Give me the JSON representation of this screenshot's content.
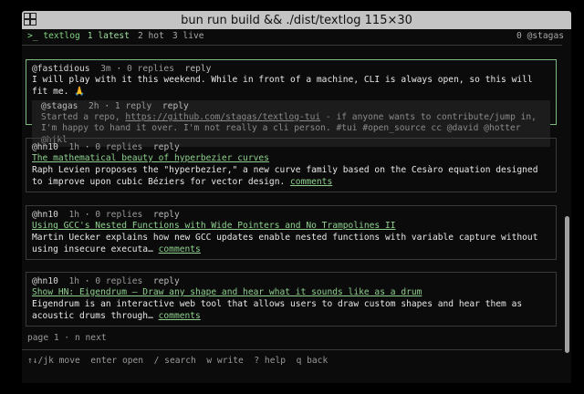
{
  "window": {
    "title": "bun run build && ./dist/textlog 115×30"
  },
  "header": {
    "prompt": ">_ textlog",
    "tabs": [
      {
        "label": "1 latest",
        "active": true
      },
      {
        "label": "2 hot",
        "active": false
      },
      {
        "label": "3 live",
        "active": false
      }
    ],
    "user": "0 @stagas"
  },
  "posts": [
    {
      "author": "@fastidious",
      "time": "3m",
      "replies": "0 replies",
      "reply_label": "reply",
      "text": "I will play with it this weekend. While in front of a machine, CLI is always open, so this will fit me. 🙏",
      "nested": {
        "author": "@stagas",
        "time": "2h",
        "replies": "1 reply",
        "reply_label": "reply",
        "text_before": "Started a repo, ",
        "link": "https://github.com/stagas/textlog-tui",
        "text_after": " - if anyone wants to contribute/jump in, I'm happy to hand it over. I'm not really a cli person. #tui #open_source cc @david @hotter @hjkl"
      }
    },
    {
      "author": "@hn10",
      "time": "1h",
      "replies": "0 replies",
      "reply_label": "reply",
      "title": "The mathematical beauty of hyperbezier curves",
      "text": "Raph Levien proposes the \"hyperbezier,\" a new curve family based on the Cesàro equation designed to improve upon cubic Béziers for vector design. ",
      "comments": "comments"
    },
    {
      "author": "@hn10",
      "time": "1h",
      "replies": "0 replies",
      "reply_label": "reply",
      "title": "Using GCC's Nested Functions with Wide Pointers and No Trampolines II",
      "text": "Martin Uecker explains how new GCC updates enable nested functions with variable capture without using insecure executa… ",
      "comments": "comments"
    },
    {
      "author": "@hn10",
      "time": "1h",
      "replies": "0 replies",
      "reply_label": "reply",
      "title": "Show HN: Eigendrum – Draw any shape and hear what it sounds like as a drum",
      "text": "Eigendrum is an interactive web tool that allows users to draw custom shapes and hear them as acoustic drums through… ",
      "comments": "comments"
    }
  ],
  "pagination": "page 1 · n next",
  "keybinds": "↑↓/jk move  enter open  / search  w write  ? help  q back"
}
